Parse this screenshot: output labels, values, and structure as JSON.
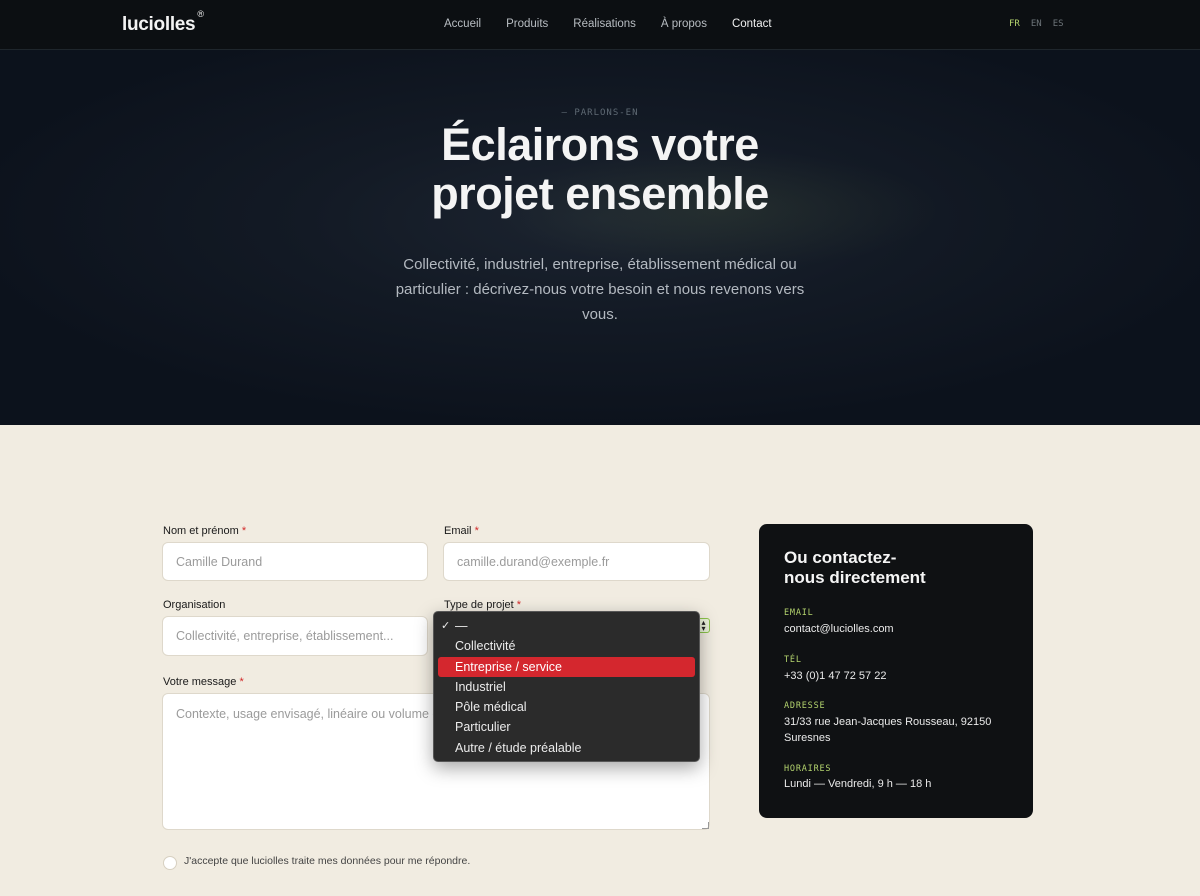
{
  "brand": {
    "name": "luciolles",
    "mark": "®"
  },
  "nav": {
    "links": [
      {
        "label": "Accueil"
      },
      {
        "label": "Produits"
      },
      {
        "label": "Réalisations"
      },
      {
        "label": "À propos"
      },
      {
        "label": "Contact"
      }
    ],
    "active": "Contact",
    "languages": [
      "FR",
      "EN",
      "ES"
    ],
    "active_language": "FR"
  },
  "hero": {
    "eyebrow": "— PARLONS-EN",
    "title_line1": "Éclairons votre",
    "title_line2": "projet ensemble",
    "subtitle": "Collectivité, industriel, entreprise, établissement médical ou particulier : décrivez-nous votre besoin et nous revenons vers vous."
  },
  "form": {
    "name": {
      "label": "Nom et prénom",
      "required": "*",
      "placeholder": "Camille Durand"
    },
    "email": {
      "label": "Email",
      "required": "*",
      "placeholder": "camille.durand@exemple.fr"
    },
    "organisation": {
      "label": "Organisation",
      "placeholder": "Collectivité, entreprise, établissement..."
    },
    "project_type": {
      "label": "Type de projet",
      "required": "*",
      "options": [
        "—",
        "Collectivité",
        "Entreprise / service",
        "Industriel",
        "Pôle médical",
        "Particulier",
        "Autre / étude préalable"
      ],
      "checked": "—",
      "highlighted": "Entreprise / service"
    },
    "message": {
      "label": "Votre message",
      "required": "*",
      "placeholder": "Contexte, usage envisagé, linéaire ou volume e"
    },
    "consent": "J'accepte que luciolles traite mes données pour me répondre."
  },
  "contact_card": {
    "title_line1": "Ou contactez-",
    "title_line2": "nous directement",
    "email_key": "EMAIL",
    "email": "contact@luciolles.com",
    "tel_key": "TÉL",
    "tel": "+33 (0)1 47 72 57 22",
    "address_key": "ADRESSE",
    "address": "31/33 rue Jean-Jacques Rousseau, 92150 Suresnes",
    "hours_key": "HORAIRES",
    "hours": "Lundi — Vendredi, 9 h — 18 h"
  },
  "colors": {
    "accent": "#b4d46e",
    "required": "#d22828",
    "highlight": "#d4272e",
    "hero_bg": "#0c121c",
    "page_bg": "#f1ece1"
  }
}
